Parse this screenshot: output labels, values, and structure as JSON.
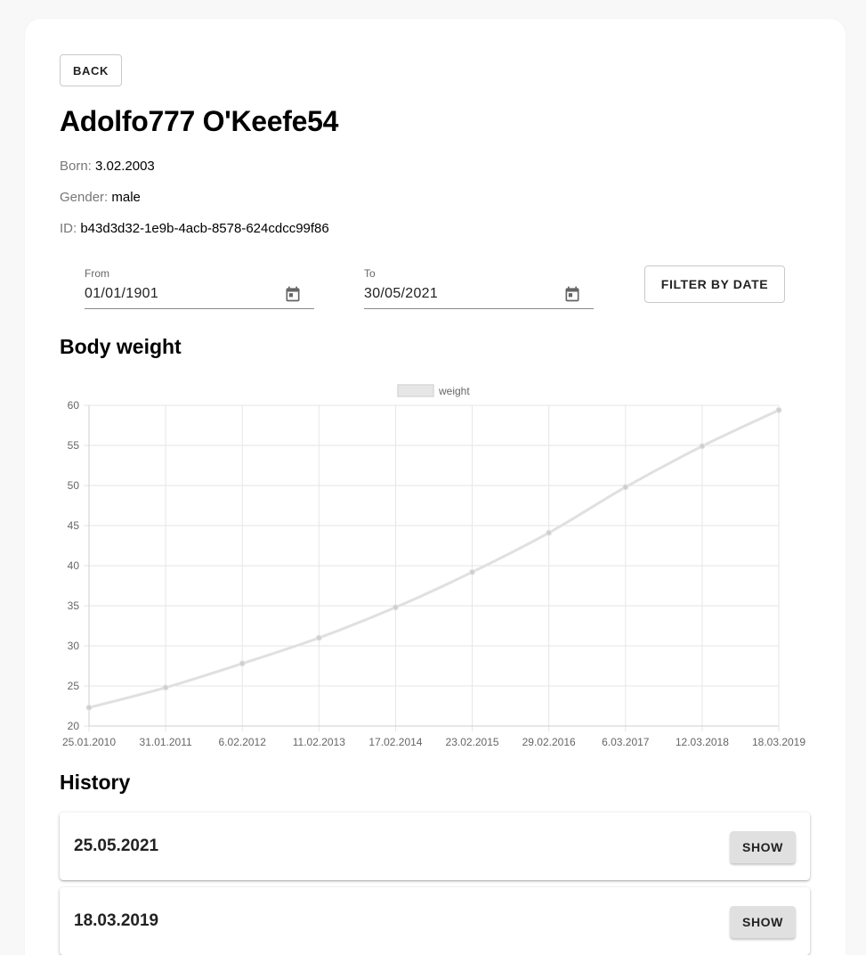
{
  "back_label": "BACK",
  "patient": {
    "name": "Adolfo777 O'Keefe54",
    "born_label": "Born:",
    "born": "3.02.2003",
    "gender_label": "Gender:",
    "gender": "male",
    "id_label": "ID:",
    "id": "b43d3d32-1e9b-4acb-8578-624cdcc99f86"
  },
  "filter": {
    "from_label": "From",
    "from_value": "01/01/1901",
    "to_label": "To",
    "to_value": "30/05/2021",
    "button_label": "FILTER BY DATE"
  },
  "body_weight_title": "Body weight",
  "history_title": "History",
  "history": [
    {
      "date": "25.05.2021",
      "button": "SHOW"
    },
    {
      "date": "18.03.2019",
      "button": "SHOW"
    }
  ],
  "icons": {
    "calendar": "calendar-icon"
  },
  "colors": {
    "series_line": "#e0e0e0",
    "series_point": "#cfcfcf",
    "grid": "#e6e6e6"
  },
  "chart_data": {
    "type": "line",
    "x": [
      "25.01.2010",
      "31.01.2011",
      "6.02.2012",
      "11.02.2013",
      "17.02.2014",
      "23.02.2015",
      "29.02.2016",
      "6.03.2017",
      "12.03.2018",
      "18.03.2019"
    ],
    "series": [
      {
        "name": "weight",
        "values": [
          22.3,
          24.8,
          27.8,
          31.0,
          34.8,
          39.2,
          44.1,
          49.8,
          54.9,
          59.4
        ]
      }
    ],
    "ylim": [
      20,
      60
    ],
    "yticks": [
      20,
      25,
      30,
      35,
      40,
      45,
      50,
      55,
      60
    ],
    "grid": true,
    "legend": "top-center"
  }
}
